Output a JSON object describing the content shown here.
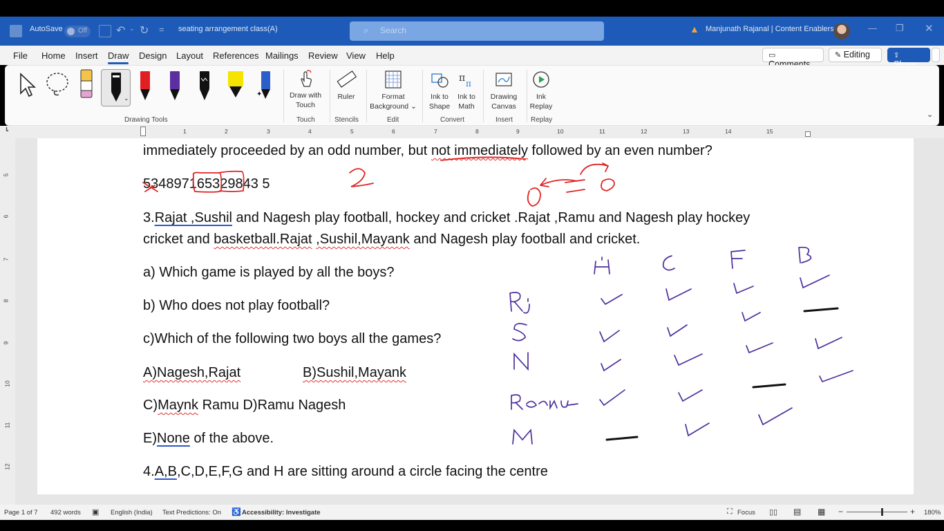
{
  "titlebar": {
    "autosave_label": "AutoSave",
    "autosave_state": "Off",
    "doc_name": "seating arrangement class(A)",
    "search_placeholder": "Search",
    "user_name": "Manjunath Rajanal | Content Enablers"
  },
  "menu": {
    "tabs": [
      "File",
      "Home",
      "Insert",
      "Draw",
      "Design",
      "Layout",
      "References",
      "Mailings",
      "Review",
      "View",
      "Help"
    ],
    "active_tab": "Draw",
    "comments_label": "Comments",
    "editing_label": "Editing",
    "share_label": "Share"
  },
  "ribbon": {
    "drawing_tools_label": "Drawing Tools",
    "draw_with_touch_line1": "Draw with",
    "draw_with_touch_line2": "Touch",
    "touch_label": "Touch",
    "ruler_label": "Ruler",
    "stencils_label": "Stencils",
    "format_bg_line1": "Format",
    "format_bg_line2": "Background",
    "edit_label": "Edit",
    "ink_to_shape_line1": "Ink to",
    "ink_to_shape_line2": "Shape",
    "ink_to_math_line1": "Ink to",
    "ink_to_math_line2": "Math",
    "convert_label": "Convert",
    "drawing_canvas_line1": "Drawing",
    "drawing_canvas_line2": "Canvas",
    "insert_label": "Insert",
    "ink_replay_line1": "Ink",
    "ink_replay_line2": "Replay",
    "replay_label": "Replay",
    "pen_colors": [
      "#111111",
      "#e02020",
      "#5b2fa0",
      "#111111",
      "#f5e400",
      "#2a5fc9"
    ]
  },
  "ruler_numbers": [
    "1",
    "2",
    "3",
    "4",
    "5",
    "6",
    "7",
    "8",
    "9",
    "10",
    "11",
    "12",
    "13",
    "14",
    "15"
  ],
  "vruler_numbers": [
    "5",
    "6",
    "7",
    "8",
    "9",
    "10",
    "11",
    "12"
  ],
  "document": {
    "line1_a": "immediately proceeded by an odd number, but ",
    "line1_b": "not immediately",
    "line1_c": " followed by an even number?",
    "sequence": "534897165329843 5",
    "q3_line1_pre": "3.",
    "q3_rajat_sushil": "Rajat ,Sushil",
    "q3_line1_post": " and Nagesh play football, hockey and cricket .Rajat ,Ramu and Nagesh play hockey",
    "q3_line2_pre": "cricket and ",
    "q3_basketball": "basketball.Rajat",
    "q3_line2_mid": " ",
    "q3_sushil_mayank": ",Sushil,Mayank",
    "q3_line2_post": " and Nagesh play football and cricket.",
    "qa": "a) Which game is played by all the boys?",
    "qb": "b) Who does not play football?",
    "qc": "c)Which of the following two boys all the games?",
    "optA": "A)Nagesh,Rajat",
    "optB": "B)Sushil,Mayank",
    "optC_pre": "C)",
    "optC_maynk": "Maynk",
    "optC_post": " Ramu  D)Ramu Nagesh",
    "optE_pre": "E)",
    "optE_none": "None",
    "optE_post": " of the above.",
    "q4_pre": "4.",
    "q4_ab": "A,B",
    "q4_post": ",C,D,E,F,G and H are sitting around a circle facing the centre"
  },
  "handwriting": {
    "answer_digit": "2",
    "columns": [
      "H",
      "C",
      "F",
      "B"
    ],
    "rows": [
      "Rj",
      "S",
      "N",
      "Raamu",
      "M"
    ]
  },
  "status": {
    "page": "Page 1 of 7",
    "words": "492 words",
    "language": "English (India)",
    "text_predictions": "Text Predictions: On",
    "accessibility": "Accessibility: Investigate",
    "focus": "Focus",
    "zoom": "180%"
  }
}
